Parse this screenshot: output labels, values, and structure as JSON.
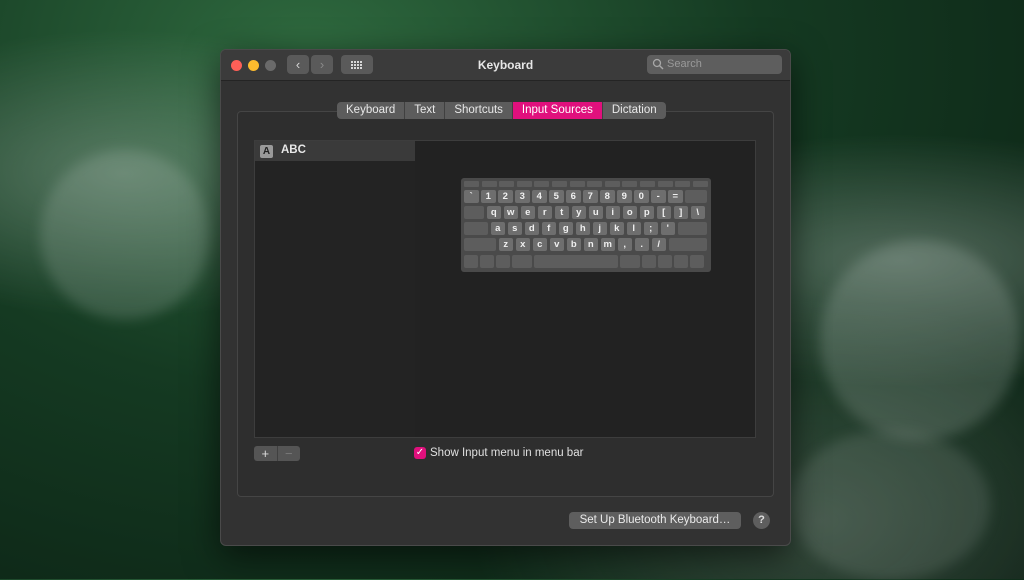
{
  "window": {
    "title": "Keyboard",
    "traffic_lights": {
      "close_color": "#ff5f57",
      "minimize_color": "#febc2e",
      "zoom_color": "#6a6a6a"
    },
    "back_icon": "chevron-left-icon",
    "forward_icon": "chevron-right-icon",
    "grid_icon": "grid-icon"
  },
  "search": {
    "placeholder": "Search",
    "icon": "search-icon"
  },
  "tabs": [
    {
      "label": "Keyboard",
      "active": false
    },
    {
      "label": "Text",
      "active": false
    },
    {
      "label": "Shortcuts",
      "active": false
    },
    {
      "label": "Input Sources",
      "active": true
    },
    {
      "label": "Dictation",
      "active": false
    }
  ],
  "accent_color": "#e0107d",
  "input_sources": [
    {
      "badge": "A",
      "label": "ABC"
    }
  ],
  "keyboard_rows": [
    [
      "`",
      "1",
      "2",
      "3",
      "4",
      "5",
      "6",
      "7",
      "8",
      "9",
      "0",
      "-",
      "="
    ],
    [
      "q",
      "w",
      "e",
      "r",
      "t",
      "y",
      "u",
      "i",
      "o",
      "p",
      "[",
      "]",
      "\\"
    ],
    [
      "a",
      "s",
      "d",
      "f",
      "g",
      "h",
      "j",
      "k",
      "l",
      ";",
      "'"
    ],
    [
      "z",
      "x",
      "c",
      "v",
      "b",
      "n",
      "m",
      ",",
      ".",
      "/"
    ]
  ],
  "list_controls": {
    "add": "+",
    "remove": "−"
  },
  "show_input_menu": {
    "label": "Show Input menu in menu bar",
    "checked": true,
    "check_glyph": "✓"
  },
  "bluetooth_button": "Set Up Bluetooth Keyboard…",
  "help_button": "?"
}
